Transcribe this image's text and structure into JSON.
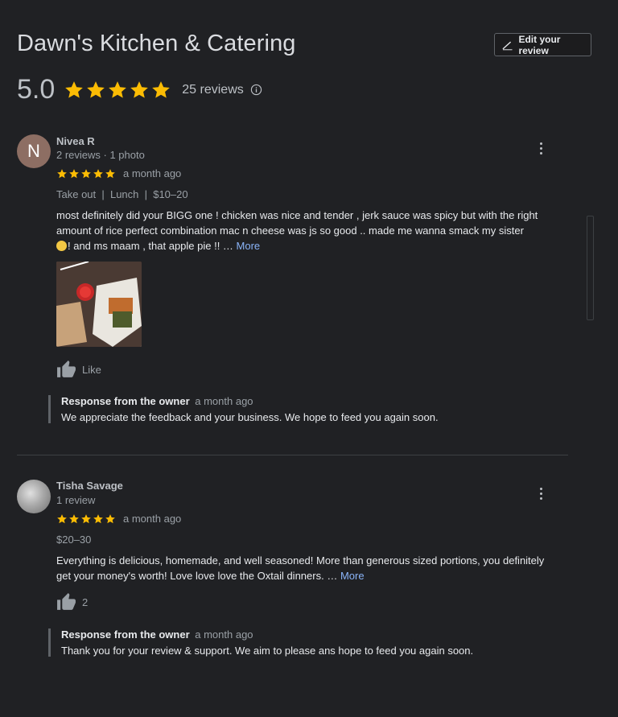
{
  "business": {
    "name": "Dawn's Kitchen & Catering",
    "rating": "5.0",
    "review_count": "25 reviews"
  },
  "edit_review_label": "Edit your review",
  "reviews": [
    {
      "initial": "N",
      "name": "Nivea R",
      "meta": "2 reviews · 1 photo",
      "stars": 5,
      "time": "a month ago",
      "tags": "Take out  |  Lunch  |  $10–20",
      "text_line1": "most definitely did your BIGG one ! chicken was nice and tender , jerk sauce was spicy but with the right",
      "text_line2": "amount of rice perfect combination mac n cheese was js so good .. made me wanna smack my sister",
      "text_line3": "! and ms maam , that apple pie !! … ",
      "more": "More",
      "like_label": "Like",
      "owner_label": "Response from the owner",
      "owner_time": "a month ago",
      "owner_text": "We appreciate the feedback and your business. We hope to feed you again soon."
    },
    {
      "name": "Tisha Savage",
      "meta": "1 review",
      "stars": 5,
      "time": "a month ago",
      "tags": "$20–30",
      "text_line1": "Everything is delicious, homemade, and well seasoned! More than generous sized portions, you definitely",
      "text_line2": "get your money's worth! Love love love the Oxtail dinners. … ",
      "more": "More",
      "like_count": "2",
      "owner_label": "Response from the owner",
      "owner_time": "a month ago",
      "owner_text": "Thank you for your review & support. We aim to please ans hope to feed you again soon."
    }
  ],
  "colors": {
    "star": "#fbbc04",
    "link": "#8ab4f8",
    "background": "#202124"
  }
}
